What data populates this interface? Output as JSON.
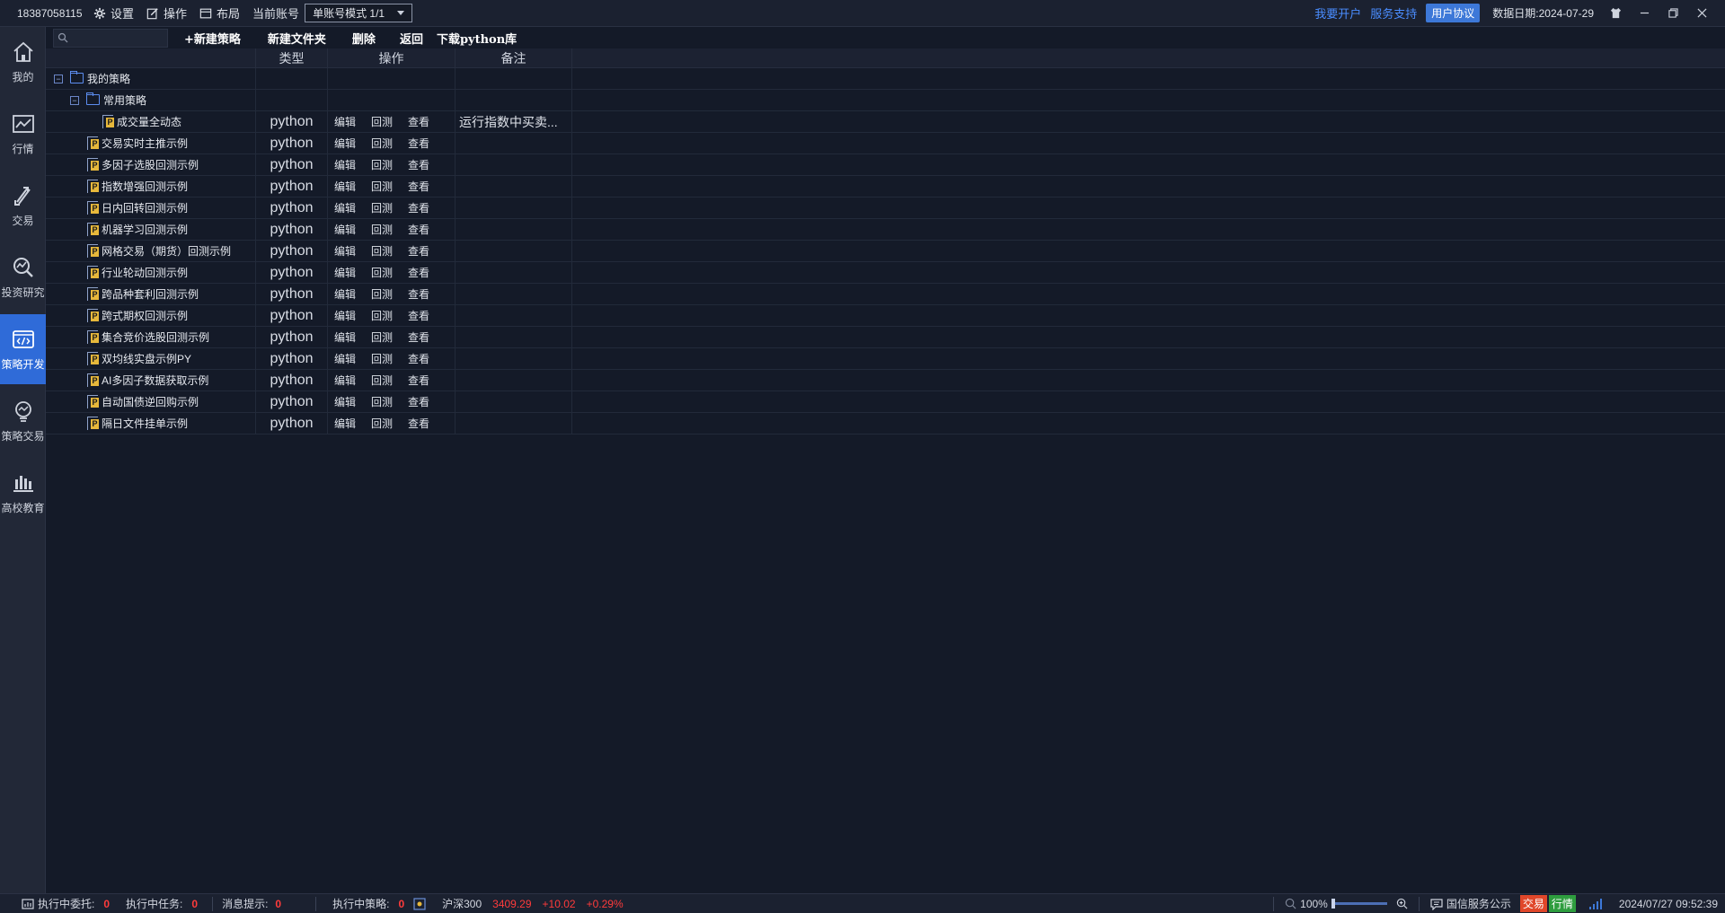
{
  "titlebar": {
    "account": "18387058115",
    "settings": "设置",
    "operations": "操作",
    "layout": "布局",
    "current_account_label": "当前账号",
    "account_mode": "单账号模式 1/1",
    "open_account": "我要开户",
    "service_support": "服务支持",
    "user_agreement": "用户协议",
    "data_date": "数据日期:2024-07-29"
  },
  "sidebar": {
    "items": [
      {
        "label": "我的",
        "icon": "home-icon"
      },
      {
        "label": "行情",
        "icon": "chart-icon"
      },
      {
        "label": "交易",
        "icon": "trade-icon"
      },
      {
        "label": "投资研究",
        "icon": "research-icon"
      },
      {
        "label": "策略开发",
        "icon": "code-icon"
      },
      {
        "label": "策略交易",
        "icon": "strategy-trade-icon"
      },
      {
        "label": "高校教育",
        "icon": "education-icon"
      }
    ],
    "active_index": 4
  },
  "toolbar": {
    "search_value": "",
    "new_strategy": "+新建策略",
    "new_folder": "新建文件夹",
    "delete": "删除",
    "back": "返回",
    "download_lib": "下载python库"
  },
  "table": {
    "headers": [
      "类型",
      "操作",
      "备注"
    ],
    "root_folder": "我的策略",
    "sub_folder": "常用策略",
    "ops": [
      "编辑",
      "回测",
      "查看"
    ],
    "rows": [
      {
        "name": "成交量全动态",
        "type": "python",
        "note": "运行指数中买卖..."
      },
      {
        "name": "交易实时主推示例",
        "type": "python",
        "note": ""
      },
      {
        "name": "多因子选股回测示例",
        "type": "python",
        "note": ""
      },
      {
        "name": "指数增强回测示例",
        "type": "python",
        "note": ""
      },
      {
        "name": "日内回转回测示例",
        "type": "python",
        "note": ""
      },
      {
        "name": "机器学习回测示例",
        "type": "python",
        "note": ""
      },
      {
        "name": "网格交易（期货）回测示例",
        "type": "python",
        "note": ""
      },
      {
        "name": "行业轮动回测示例",
        "type": "python",
        "note": ""
      },
      {
        "name": "跨品种套利回测示例",
        "type": "python",
        "note": ""
      },
      {
        "name": "跨式期权回测示例",
        "type": "python",
        "note": ""
      },
      {
        "name": "集合竞价选股回测示例",
        "type": "python",
        "note": ""
      },
      {
        "name": "双均线实盘示例PY",
        "type": "python",
        "note": ""
      },
      {
        "name": "AI多因子数据获取示例",
        "type": "python",
        "note": ""
      },
      {
        "name": "自动国债逆回购示例",
        "type": "python",
        "note": ""
      },
      {
        "name": "隔日文件挂单示例",
        "type": "python",
        "note": ""
      }
    ]
  },
  "statusbar": {
    "executing_orders_label": "执行中委托:",
    "executing_orders": "0",
    "executing_tasks_label": "执行中任务:",
    "executing_tasks": "0",
    "messages_label": "消息提示:",
    "messages": "0",
    "executing_strategies_label": "执行中策略:",
    "executing_strategies": "0",
    "index_name": "沪深300",
    "index_value": "3409.29",
    "index_change": "+10.02",
    "index_pct": "+0.29%",
    "zoom": "100%",
    "notice": "国信服务公示",
    "tag_trade": "交易",
    "tag_quote": "行情",
    "datetime": "2024/07/27 09:52:39"
  },
  "colors": {
    "background": "#141a28",
    "sidebar": "#222837",
    "accent": "#2f6bd8",
    "negative": "#ff3b3b"
  }
}
